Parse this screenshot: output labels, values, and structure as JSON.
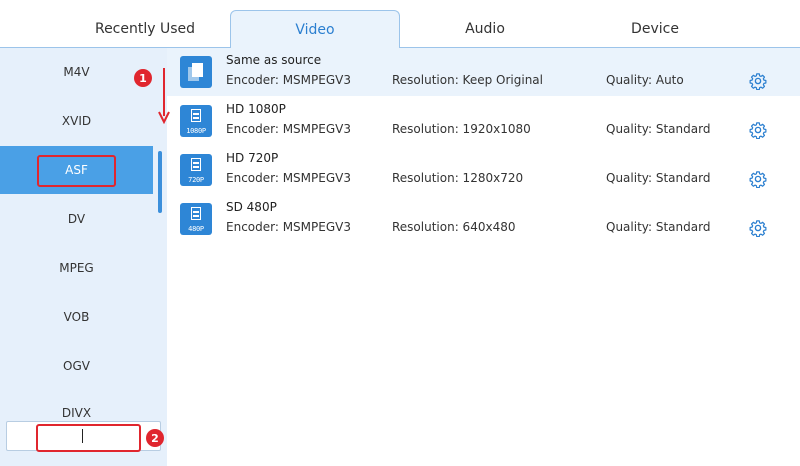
{
  "tabs": [
    {
      "label": "Recently Used"
    },
    {
      "label": "Video"
    },
    {
      "label": "Audio"
    },
    {
      "label": "Device"
    }
  ],
  "active_tab": "Video",
  "sidebar": {
    "items": [
      {
        "label": "M4V"
      },
      {
        "label": "XVID"
      },
      {
        "label": "ASF"
      },
      {
        "label": "DV"
      },
      {
        "label": "MPEG"
      },
      {
        "label": "VOB"
      },
      {
        "label": "OGV"
      },
      {
        "label": "DIVX"
      }
    ],
    "selected": "ASF",
    "search": {
      "value": "",
      "placeholder": ""
    }
  },
  "presets": [
    {
      "name": "Same as source",
      "encoder": "Encoder: MSMPEGV3",
      "resolution": "Resolution: Keep Original",
      "quality": "Quality: Auto",
      "icon": "copy-icon",
      "badge": ""
    },
    {
      "name": "HD 1080P",
      "encoder": "Encoder: MSMPEGV3",
      "resolution": "Resolution: 1920x1080",
      "quality": "Quality: Standard",
      "icon": "film-icon",
      "badge": "1080P"
    },
    {
      "name": "HD 720P",
      "encoder": "Encoder: MSMPEGV3",
      "resolution": "Resolution: 1280x720",
      "quality": "Quality: Standard",
      "icon": "film-icon",
      "badge": "720P"
    },
    {
      "name": "SD 480P",
      "encoder": "Encoder: MSMPEGV3",
      "resolution": "Resolution: 640x480",
      "quality": "Quality: Standard",
      "icon": "film-icon",
      "badge": "480P"
    }
  ],
  "annotations": {
    "step1": "1",
    "step2": "2"
  },
  "colors": {
    "accent": "#2b7fd0",
    "selected_bg": "#4aa0e6",
    "sidebar_bg": "#e6f0fb",
    "annotation": "#e0262e"
  }
}
